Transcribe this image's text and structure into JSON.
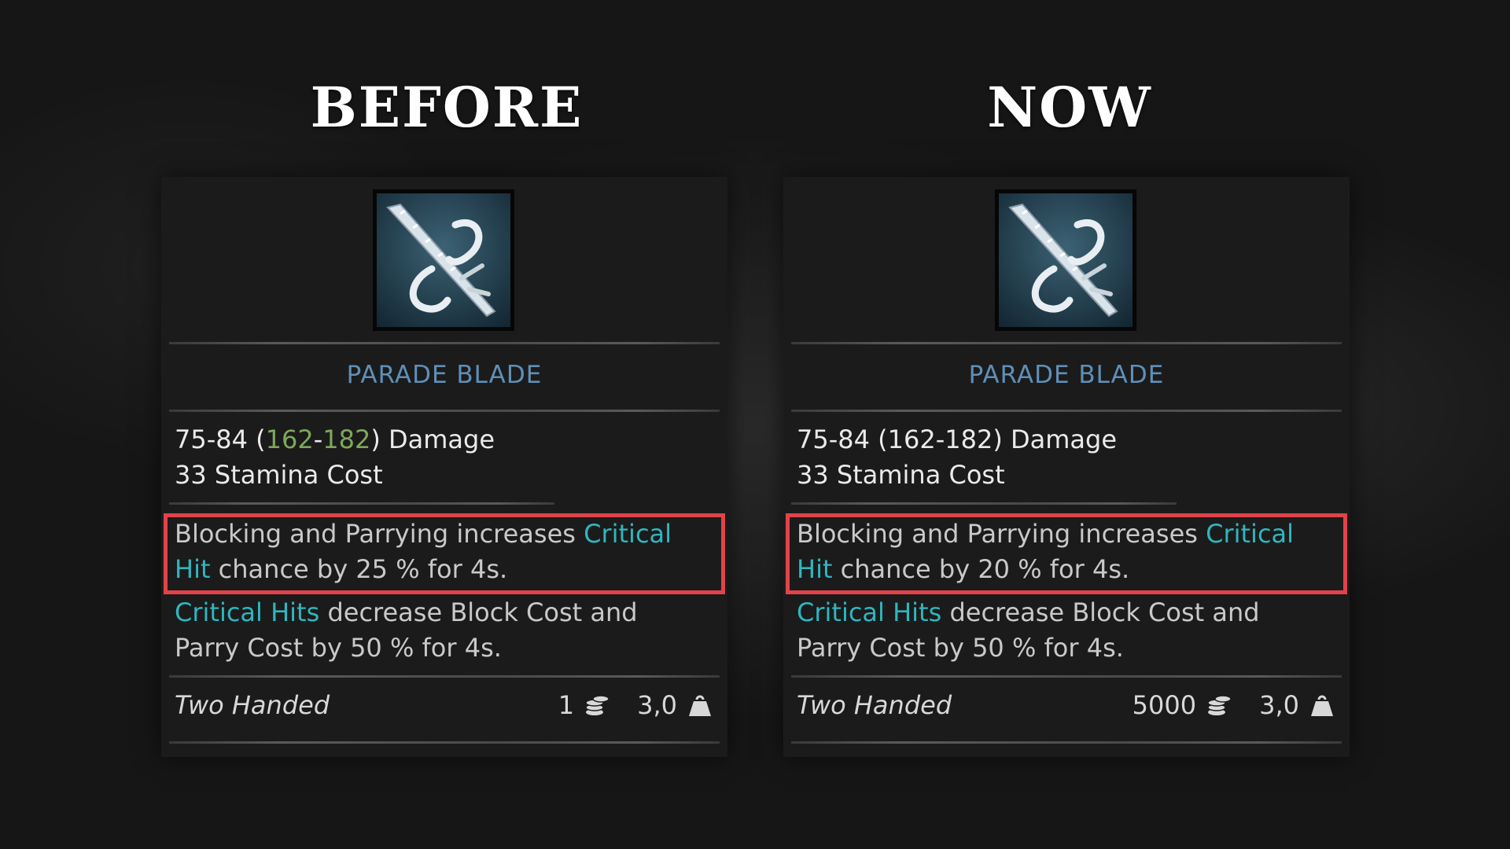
{
  "headings": {
    "left": "BEFORE",
    "right": "NOW"
  },
  "colors": {
    "item_name": "#5f8fb8",
    "keyword": "#2fb6bf",
    "bonus_damage": "#7fa85a",
    "highlight_border": "#e2434a"
  },
  "before": {
    "item_name": "PARADE BLADE",
    "damage": {
      "base": "75-84",
      "open": " (",
      "bonus_min": "162",
      "sep": "-",
      "bonus_max": "182",
      "close": ")",
      "suffix": " Damage"
    },
    "stamina": "33 Stamina Cost",
    "effect1": {
      "a": "Blocking and Parrying increases ",
      "kw1": "Critical",
      "kw2": "Hit",
      "b": " chance by 25 % for 4s."
    },
    "effect2": {
      "kw": "Critical Hits",
      "a": " decrease Block Cost and",
      "b": "Parry Cost by 50 % for 4s."
    },
    "footer": {
      "type": "Two Handed",
      "value": "1",
      "value_icon": "coin-stack-icon",
      "weight": "3,0",
      "weight_icon": "weight-icon"
    }
  },
  "now": {
    "item_name": "PARADE BLADE",
    "damage": {
      "base": "75-84",
      "open": " (",
      "bonus_min": "162",
      "sep": "-",
      "bonus_max": "182",
      "close": ")",
      "suffix": " Damage"
    },
    "stamina": "33 Stamina Cost",
    "effect1": {
      "a": "Blocking and Parrying increases ",
      "kw1": "Critical",
      "kw2": "Hit",
      "b": " chance by 20 % for 4s."
    },
    "effect2": {
      "kw": "Critical Hits",
      "a": " decrease Block Cost and",
      "b": "Parry Cost by 50 % for 4s."
    },
    "footer": {
      "type": "Two Handed",
      "value": "5000",
      "value_icon": "coin-stack-icon",
      "weight": "3,0",
      "weight_icon": "weight-icon"
    }
  }
}
